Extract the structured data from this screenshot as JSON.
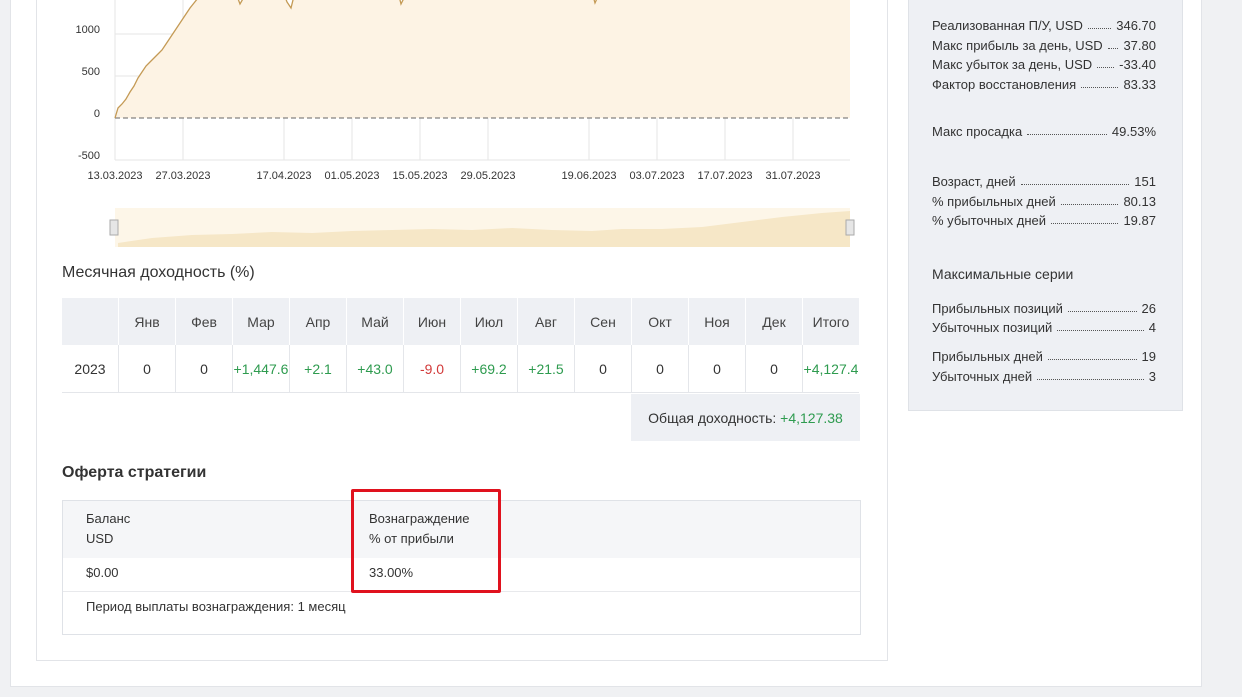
{
  "chart": {
    "y_ticks": [
      "1000",
      "500",
      "0",
      "-500"
    ],
    "x_ticks": [
      "13.03.2023",
      "27.03.2023",
      "17.04.2023",
      "01.05.2023",
      "15.05.2023",
      "29.05.2023",
      "19.06.2023",
      "03.07.2023",
      "17.07.2023",
      "31.07.2023"
    ],
    "line_color": "#c49a55",
    "fill_color": "#fdf3e4"
  },
  "monthly": {
    "title": "Месячная доходность (%)",
    "headers": [
      "",
      "Янв",
      "Фев",
      "Мар",
      "Апр",
      "Май",
      "Июн",
      "Июл",
      "Авг",
      "Сен",
      "Окт",
      "Ноя",
      "Дек",
      "Итого"
    ],
    "rows": [
      {
        "year": "2023",
        "values": [
          "0",
          "0",
          "+1,447.6",
          "+2.1",
          "+43.0",
          "-9.0",
          "+69.2",
          "+21.5",
          "0",
          "0",
          "0",
          "0",
          "+4,127.4"
        ]
      }
    ],
    "total_label": "Общая доходность:",
    "total_value": "+4,127.38"
  },
  "offer": {
    "title": "Оферта стратегии",
    "balance_label": "Баланс",
    "balance_unit": "USD",
    "balance_value": "$0.00",
    "reward_label": "Вознаграждение",
    "reward_unit": "% от прибыли",
    "reward_value": "33.00%",
    "payout_period": "Период выплаты вознаграждения: 1 месяц"
  },
  "stats": {
    "realized_pl_label": "Реализованная П/У, USD",
    "realized_pl": "346.70",
    "max_day_profit_label": "Макс прибыль за день, USD",
    "max_day_profit": "37.80",
    "max_day_loss_label": "Макс убыток за день, USD",
    "max_day_loss": "-33.40",
    "recovery_factor_label": "Фактор восстановления",
    "recovery_factor": "83.33",
    "max_drawdown_label": "Макс просадка",
    "max_drawdown": "49.53%",
    "age_label": "Возраст, дней",
    "age": "151",
    "profit_days_pct_label": "% прибыльных дней",
    "profit_days_pct": "80.13",
    "loss_days_pct_label": "% убыточных дней",
    "loss_days_pct": "19.87",
    "series_heading": "Максимальные серии",
    "win_positions_label": "Прибыльных позиций",
    "win_positions": "26",
    "loss_positions_label": "Убыточных позиций",
    "loss_positions": "4",
    "win_days_label": "Прибыльных дней",
    "win_days": "19",
    "loss_days_label": "Убыточных дней",
    "loss_days": "3"
  }
}
